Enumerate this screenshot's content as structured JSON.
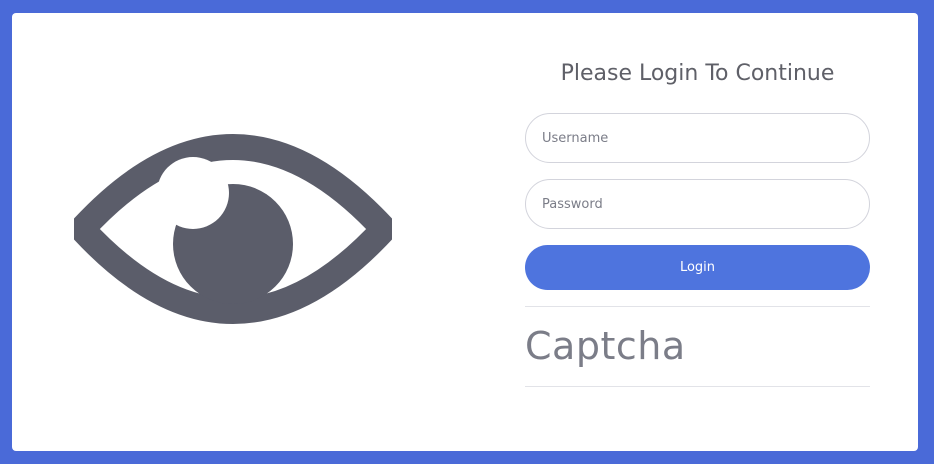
{
  "login": {
    "title": "Please Login To Continue",
    "username_placeholder": "Username",
    "password_placeholder": "Password",
    "button_label": "Login",
    "captcha_text": "Captcha"
  },
  "icons": {
    "logo": "eye-icon"
  },
  "colors": {
    "page_background": "#4a6ad8",
    "card_background": "#ffffff",
    "accent": "#4e74de",
    "icon": "#5b5d6a",
    "text": "#5f6068",
    "muted_text": "#7b7d88"
  }
}
